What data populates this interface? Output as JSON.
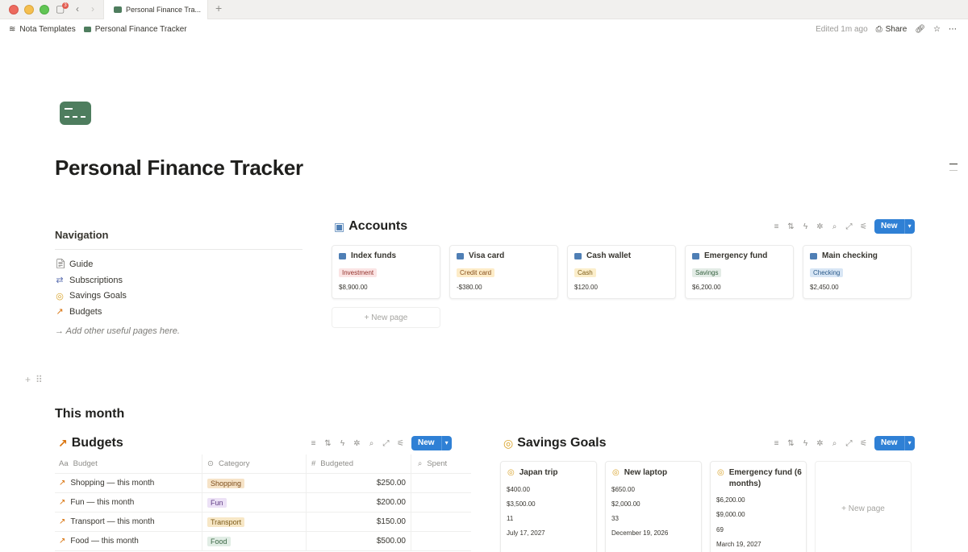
{
  "window": {
    "tab_title": "Personal Finance Tra...",
    "sidebar_badge": "3"
  },
  "topbar": {
    "breadcrumb": [
      "Nota Templates",
      "Personal Finance Tracker"
    ],
    "edited": "Edited 1m ago",
    "share_label": "Share"
  },
  "page": {
    "title": "Personal Finance Tracker"
  },
  "navigation": {
    "heading": "Navigation",
    "items": [
      {
        "label": "Guide",
        "icon": "document-icon"
      },
      {
        "label": "Subscriptions",
        "icon": "repeat-icon"
      },
      {
        "label": "Savings Goals",
        "icon": "target-icon"
      },
      {
        "label": "Budgets",
        "icon": "chart-trend-icon"
      }
    ],
    "hint": "→ Add other useful pages here."
  },
  "accounts": {
    "title": "Accounts",
    "new_label": "New",
    "new_page_label": "New page",
    "cards": [
      {
        "name": "Index funds",
        "type": "Investment",
        "amount": "$8,900.00",
        "tag_bg": "#fbe4e4",
        "tag_fg": "#93312a"
      },
      {
        "name": "Visa card",
        "type": "Credit card",
        "amount": "-$380.00",
        "tag_bg": "#fdecc8",
        "tag_fg": "#874f1c"
      },
      {
        "name": "Cash wallet",
        "type": "Cash",
        "amount": "$120.00",
        "tag_bg": "#fbeecb",
        "tag_fg": "#7b5a15"
      },
      {
        "name": "Emergency fund",
        "type": "Savings",
        "amount": "$6,200.00",
        "tag_bg": "#e3ece6",
        "tag_fg": "#35613f"
      },
      {
        "name": "Main checking",
        "type": "Checking",
        "amount": "$2,450.00",
        "tag_bg": "#d8e6f5",
        "tag_fg": "#2b5a8a"
      }
    ]
  },
  "this_month": {
    "heading": "This month"
  },
  "budgets": {
    "title": "Budgets",
    "new_label": "New",
    "columns": [
      "Budget",
      "Category",
      "Budgeted",
      "Spent"
    ],
    "rows": [
      {
        "name": "Shopping — this month",
        "category": "Shopping",
        "budgeted": "$250.00",
        "cat_bg": "#f6e3c7",
        "cat_fg": "#7c4d1c"
      },
      {
        "name": "Fun — this month",
        "category": "Fun",
        "budgeted": "$200.00",
        "cat_bg": "#ece1f6",
        "cat_fg": "#5d3a83"
      },
      {
        "name": "Transport — this month",
        "category": "Transport",
        "budgeted": "$150.00",
        "cat_bg": "#f7e7c6",
        "cat_fg": "#7c5a18"
      },
      {
        "name": "Food — this month",
        "category": "Food",
        "budgeted": "$500.00",
        "cat_bg": "#e1ede5",
        "cat_fg": "#3a6644"
      }
    ]
  },
  "savings_goals": {
    "title": "Savings Goals",
    "new_label": "New",
    "new_page_label": "New page",
    "cards": [
      {
        "name": "Japan trip",
        "saved": "$400.00",
        "target": "$3,500.00",
        "number": "11",
        "date": "July 17, 2027"
      },
      {
        "name": "New laptop",
        "saved": "$650.00",
        "target": "$2,000.00",
        "number": "33",
        "date": "December 19, 2026"
      },
      {
        "name": "Emergency fund (6 months)",
        "saved": "$6,200.00",
        "target": "$9,000.00",
        "number": "69",
        "date": "March 19, 2027"
      }
    ]
  },
  "colors": {
    "accent": "#2f80d5",
    "page_icon": "#4e7d5e"
  }
}
